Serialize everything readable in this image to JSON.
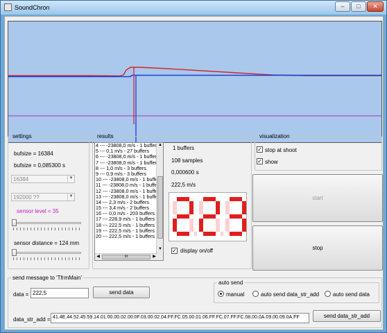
{
  "window": {
    "title": "SoundChron",
    "min_glyph": "–",
    "max_glyph": "□",
    "close_glyph": "✕"
  },
  "settings": {
    "group": "settings",
    "bufsize_samples": "bufsize = 16384",
    "bufsize_seconds": "bufsize = 0,085300 s",
    "combo_bufsize": "16384",
    "combo_samplerate": "192000 ??",
    "sensor_level": "sensor level = 35",
    "sensor_distance": "sensor distance = 124 mm"
  },
  "results": {
    "group": "results",
    "items": [
      "4 --- -23808,0 m/s - 1 buffers",
      "5 --- 0,1 m/s - 27 buffers",
      "6 --- -23808,0 m/s - 1 buffers",
      "7 --- -23808,0 m/s - 1 buffers",
      "8 --- 1,0 m/s - 3 buffers",
      "9 --- 0,9 m/s - 3 buffers",
      "10 --- -23808,0 m/s - 1 buffers",
      "11 --- -23808,0 m/s - 1 buffers",
      "12 --- -23808,0 m/s - 1 buffers",
      "13 --- -23808,0 m/s - 1 buffers",
      "14 --- 2,3 m/s - 2 buffers",
      "15 --- 3,4 m/s - 2 buffers",
      "16 --- 0,0 m/s - 203 buffers",
      "17 --- 228,9 m/s - 1 buffers",
      "18 --- 222,5 m/s - 1 buffers",
      "19 --- 222,5 m/s - 1 buffers",
      "20 --- 222,5 m/s - 1 buffers"
    ],
    "scroll_grip": "III",
    "buffers": "1 buffers",
    "samples": "108 samples",
    "time": "0,000600 s",
    "speed": "222,5 m/s",
    "display": "223",
    "display_toggle": "display on/off"
  },
  "visualization": {
    "group": "visualization",
    "stop_at_shoot": "stop at shoot",
    "show": "show",
    "start": "start",
    "stop": "stop"
  },
  "send": {
    "group": "send message to 'TfrmMain'",
    "data_label": "data =",
    "data_value": "222,5",
    "send_data": "send data",
    "auto_send": "auto send",
    "manual": "manual",
    "auto_send_data_str_add": "auto send data_str_add",
    "auto_send_data": "auto send data",
    "str_label": "data_str_add =",
    "str_value": "41.4E.44.52.45.59.14.01.00.00.02.00.0F.03.00.02.04.FF.FC.05.00.01.06.FF.FC.07.FF.FC.08.00.0A.09.00.09.0A.FF",
    "send_str": "send data_str_add"
  },
  "colors": {
    "plot_bg": "#a9c8ec",
    "trace_red": "#d8232a",
    "trace_blue": "#1b3fd6",
    "threshold": "#b42ec8",
    "seg_on": "#e01e1e",
    "seg_off": "#ffd0d0"
  }
}
